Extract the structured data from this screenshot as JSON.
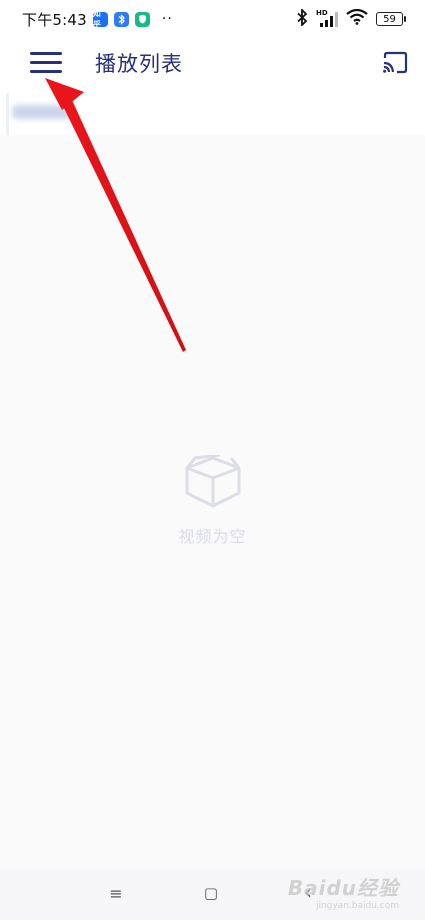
{
  "status_bar": {
    "time": "下午5:43",
    "badges": [
      {
        "name": "zhihu-app-icon",
        "label": "知乎",
        "color": "#1772f6"
      },
      {
        "name": "bluetooth-app-icon",
        "label": "",
        "color": "#2f7cf6"
      },
      {
        "name": "shield-app-icon",
        "label": "",
        "color": "#19b98a"
      }
    ],
    "more": "··",
    "network": "HD",
    "battery": "59"
  },
  "header": {
    "title": "播放列表"
  },
  "empty_state": {
    "message": "视频为空"
  },
  "nav_bar": {
    "recent_icon": "≡",
    "home_icon": "▢",
    "back_icon": "‹"
  },
  "watermark": {
    "brand": "Baidu经验",
    "sub": "jingyan.baidu.com"
  },
  "colors": {
    "accent": "#27317a",
    "arrow": "#e8161b",
    "empty_icon": "#dcdde8"
  }
}
